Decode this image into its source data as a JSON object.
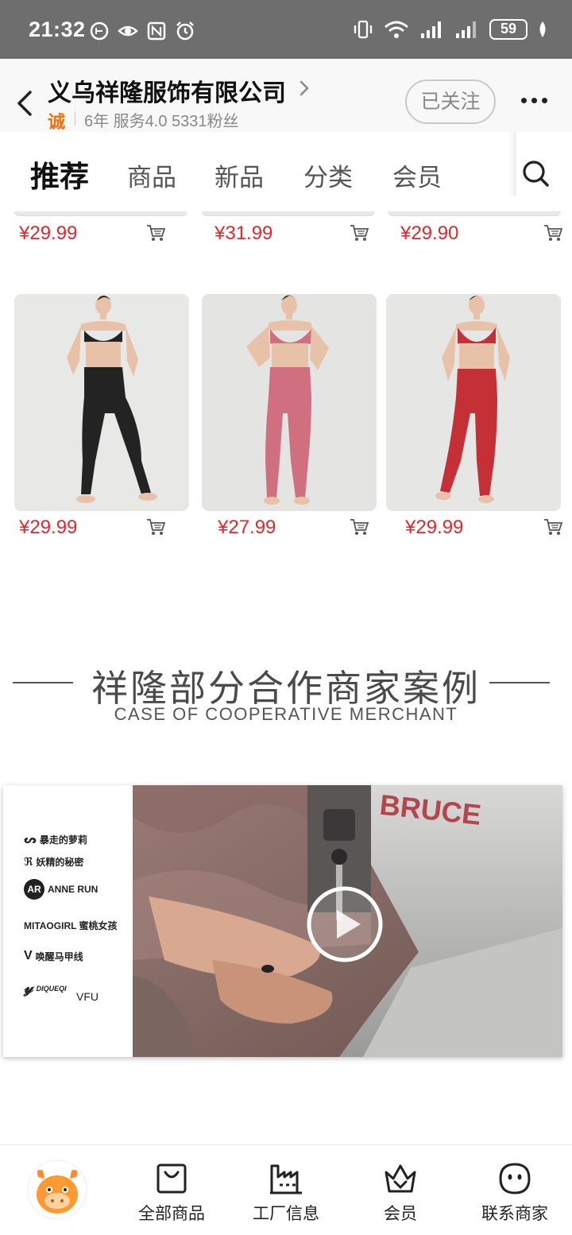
{
  "status_bar": {
    "time": "21:32",
    "battery": "59",
    "network": "5G"
  },
  "header": {
    "shop_name": "义乌祥隆服饰有限公司",
    "cert_badge": "诚",
    "meta": "6年  服务4.0  5331粉丝",
    "follow_label": "已关注"
  },
  "tabs": [
    {
      "label": "推荐",
      "active": true
    },
    {
      "label": "商品",
      "active": false
    },
    {
      "label": "新品",
      "active": false
    },
    {
      "label": "分类",
      "active": false
    },
    {
      "label": "会员",
      "active": false
    }
  ],
  "products_row1": [
    {
      "price": "¥29.99"
    },
    {
      "price": "¥31.99"
    },
    {
      "price": "¥29.90"
    }
  ],
  "products_row2": [
    {
      "price": "¥29.99",
      "color": "#2a2a2a"
    },
    {
      "price": "¥27.99",
      "color": "#cf6f7f"
    },
    {
      "price": "¥29.99",
      "color": "#c43035"
    }
  ],
  "section": {
    "title": "祥隆部分合作商家案例",
    "subtitle": "CASE OF COOPERATIVE MERCHANT"
  },
  "banner": {
    "brands": [
      "暴走的萝莉",
      "妖精的秘密",
      "ANNE RUN",
      "MITAOGIRL 蜜桃女孩",
      "唤醒马甲线",
      "DIQUEQI",
      "VFU"
    ],
    "photo_text": "BRUCE"
  },
  "bottom_nav": [
    {
      "label": "全部商品",
      "icon": "bag-icon"
    },
    {
      "label": "工厂信息",
      "icon": "factory-icon"
    },
    {
      "label": "会员",
      "icon": "crown-icon"
    },
    {
      "label": "联系商家",
      "icon": "chat-icon"
    }
  ]
}
